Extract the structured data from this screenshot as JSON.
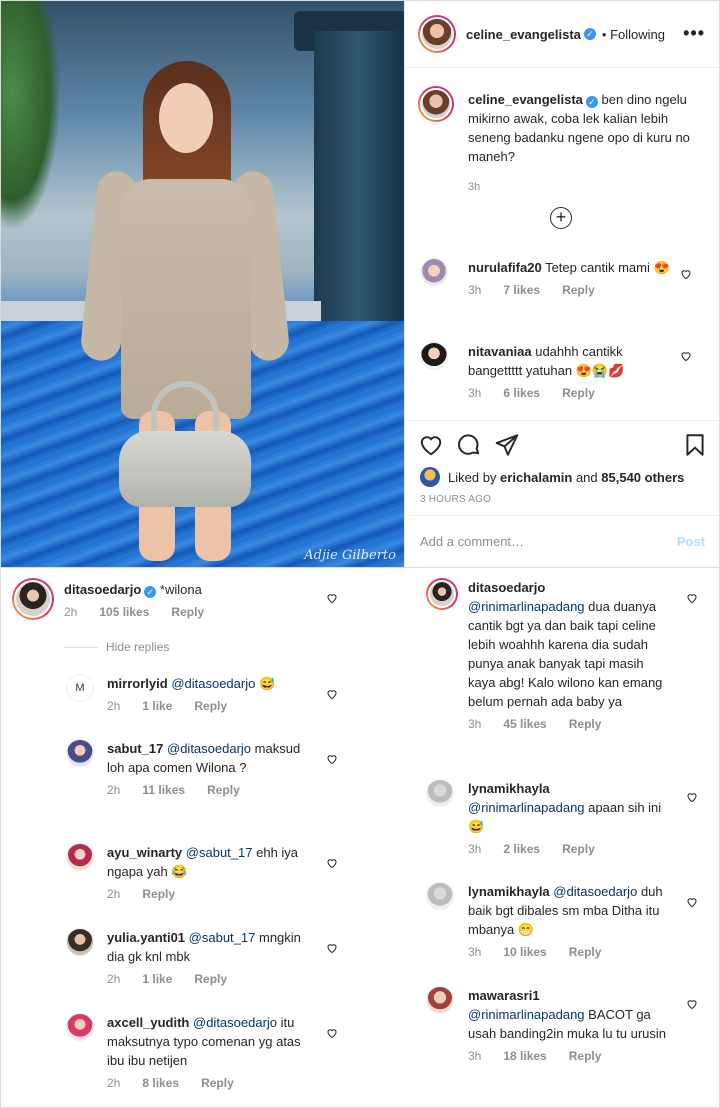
{
  "post": {
    "username": "celine_evangelista",
    "follow_text": "• Following",
    "more_label": "•••",
    "caption": "ben dino ngelu mikirno awak, coba lek kalian lebih seneng badanku ngene opo di kuru no maneh?",
    "caption_time": "3h",
    "photo_watermark": "Adjie Gilberto",
    "liked_by_prefix": "Liked by",
    "liked_by_user": "erichalamin",
    "liked_by_and": "and",
    "liked_by_others": "85,540 others",
    "time_ago": "3 HOURS AGO",
    "add_comment_placeholder": "Add a comment…",
    "post_label": "Post"
  },
  "top_comments": [
    {
      "user": "nurulafifa20",
      "text": "Tetep cantik mami 😍",
      "time": "3h",
      "likes": "7 likes",
      "reply": "Reply"
    },
    {
      "user": "nitavaniaa",
      "text": "udahhh cantikk bangettttt yatuhan 😍😭💋",
      "time": "3h",
      "likes": "6 likes",
      "reply": "Reply"
    }
  ],
  "left_thread": {
    "parent": {
      "user": "ditasoedarjo",
      "text": "*wilona",
      "time": "2h",
      "likes": "105 likes",
      "reply": "Reply"
    },
    "hide_replies": "Hide replies",
    "replies": [
      {
        "user": "mirrorlyid",
        "mention": "@ditasoedarjo",
        "text": "😅",
        "time": "2h",
        "likes": "1 like",
        "reply": "Reply",
        "avatar_letter": "M"
      },
      {
        "user": "sabut_17",
        "mention": "@ditasoedarjo",
        "text": "maksud loh apa comen Wilona ?",
        "time": "2h",
        "likes": "11 likes",
        "reply": "Reply"
      },
      {
        "user": "ayu_winarty",
        "mention": "@sabut_17",
        "text": "ehh iya ngapa yah 😂",
        "time": "2h",
        "likes": "",
        "reply": "Reply"
      },
      {
        "user": "yulia.yanti01",
        "mention": "@sabut_17",
        "text": "mngkin dia gk knl mbk",
        "time": "2h",
        "likes": "1 like",
        "reply": "Reply"
      },
      {
        "user": "axcell_yudith",
        "mention": "@ditasoedarjo",
        "text": "itu maksutnya typo comenan yg atas ibu ibu netijen",
        "time": "2h",
        "likes": "8 likes",
        "reply": "Reply"
      }
    ]
  },
  "right_thread": [
    {
      "user": "ditasoedarjo",
      "mention": "@rinimarlinapadang",
      "text": "dua duanya cantik bgt ya dan baik tapi celine lebih woahhh karena dia sudah punya anak banyak tapi masih kaya abg! Kalo wilono kan emang belum pernah ada baby ya",
      "time": "3h",
      "likes": "45 likes",
      "reply": "Reply"
    },
    {
      "user": "lynamikhayla",
      "mention": "@rinimarlinapadang",
      "text": "apaan sih ini 😅",
      "time": "3h",
      "likes": "2 likes",
      "reply": "Reply"
    },
    {
      "user": "lynamikhayla",
      "mention": "@ditasoedarjo",
      "text": "duh baik bgt dibales sm mba Ditha itu mbanya 😁",
      "time": "3h",
      "likes": "10 likes",
      "reply": "Reply"
    },
    {
      "user": "mawarasri1",
      "mention": "@rinimarlinapadang",
      "text": "BACOT ga usah banding2in muka lu tu urusin",
      "time": "3h",
      "likes": "18 likes",
      "reply": "Reply"
    }
  ],
  "colors": {
    "verified": "#3897f0",
    "mention": "#00376b",
    "meta": "#8e8e8e",
    "post_button": "#b2dffc"
  }
}
